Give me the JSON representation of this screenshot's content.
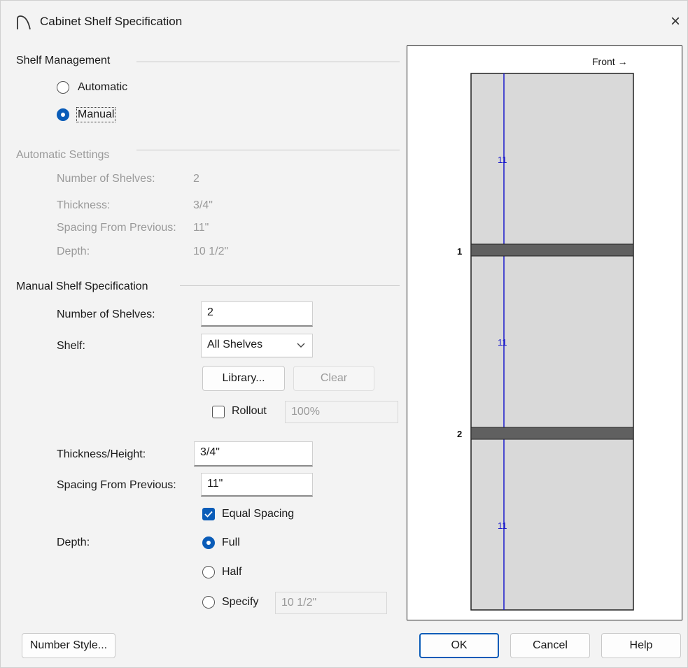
{
  "window": {
    "title": "Cabinet Shelf Specification",
    "app_icon": "arch-icon",
    "close_icon": "close-icon",
    "close_glyph": "×"
  },
  "shelf_management": {
    "title": "Shelf Management",
    "options": [
      {
        "label": "Automatic",
        "checked": false
      },
      {
        "label": "Manual",
        "checked": true
      }
    ]
  },
  "automatic_settings": {
    "title": "Automatic Settings",
    "rows": [
      {
        "label": "Number of Shelves:",
        "value": "2"
      },
      {
        "label": "Thickness:",
        "value": "3/4\""
      },
      {
        "label": "Spacing From Previous:",
        "value": "11\""
      },
      {
        "label": "Depth:",
        "value": "10 1/2\""
      }
    ]
  },
  "manual_spec": {
    "title": "Manual Shelf Specification",
    "number_of_shelves_label": "Number of Shelves:",
    "number_of_shelves_value": "2",
    "shelf_label": "Shelf:",
    "shelf_selected": "All Shelves",
    "library_button": "Library...",
    "clear_button": "Clear",
    "rollout_label": "Rollout",
    "rollout_checked": false,
    "rollout_value": "100%",
    "thickness_label": "Thickness/Height:",
    "thickness_value": "3/4\"",
    "spacing_label": "Spacing From Previous:",
    "spacing_value": "11\"",
    "equal_spacing_label": "Equal Spacing",
    "equal_spacing_checked": true,
    "depth_label": "Depth:",
    "depth_options": [
      {
        "label": "Full",
        "checked": true
      },
      {
        "label": "Half",
        "checked": false
      },
      {
        "label": "Specify",
        "checked": false
      }
    ],
    "specify_value": "10 1/2\""
  },
  "preview": {
    "front_label": "Front",
    "front_arrow": "→",
    "shelf_numbers": [
      "1",
      "2"
    ],
    "spacing_labels": [
      "11",
      "11",
      "11"
    ],
    "colors": {
      "cabinet_fill": "#d9d9d9",
      "shelf_fill": "#606060",
      "dimension_line": "#1a1acc"
    }
  },
  "footer": {
    "number_style_button": "Number Style...",
    "ok_button": "OK",
    "cancel_button": "Cancel",
    "help_button": "Help"
  },
  "colors": {
    "accent": "#0a5cb8",
    "dialog_bg": "#f3f3f3",
    "disabled_text": "#9a9a9a"
  }
}
